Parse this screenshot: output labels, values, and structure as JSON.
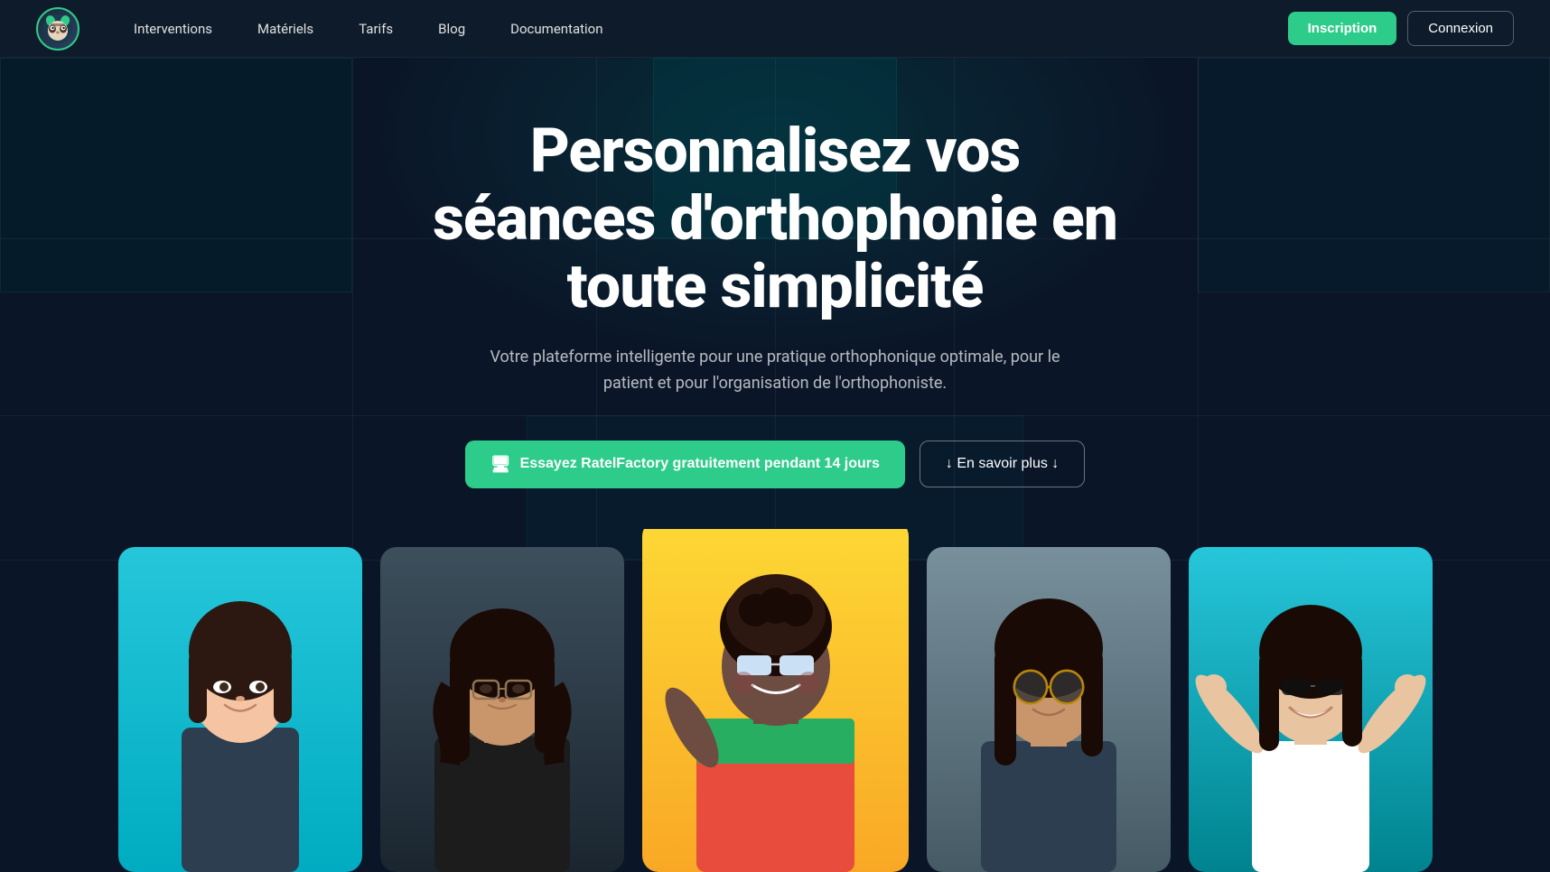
{
  "nav": {
    "links": [
      {
        "id": "interventions",
        "label": "Interventions"
      },
      {
        "id": "materiels",
        "label": "Matériels"
      },
      {
        "id": "tarifs",
        "label": "Tarifs"
      },
      {
        "id": "blog",
        "label": "Blog"
      },
      {
        "id": "documentation",
        "label": "Documentation"
      }
    ],
    "cta_primary": "Inscription",
    "cta_secondary": "Connexion"
  },
  "hero": {
    "title": "Personnalisez vos séances d'orthophonie en toute simplicité",
    "subtitle": "Votre plateforme intelligente pour une pratique orthophonique optimale, pour le patient et pour l'organisation de l'orthophoniste.",
    "btn_primary_icon": "🖥",
    "btn_primary": "Essayez RatelFactory gratuitement pendant 14 jours",
    "btn_secondary": "↓ En savoir plus ↓"
  },
  "photos": [
    {
      "id": "photo-1",
      "bg": "#00bcd4",
      "desc": "Young Asian woman smiling, cyan background"
    },
    {
      "id": "photo-2",
      "bg": "#2d3436",
      "desc": "Woman with glasses in dark setting"
    },
    {
      "id": "photo-3",
      "bg": "#fdd835",
      "desc": "Black woman with braids, yellow background, sunglasses"
    },
    {
      "id": "photo-4",
      "bg": "#90a4ae",
      "desc": "Woman with sunglasses, grey background"
    },
    {
      "id": "photo-5",
      "bg": "#00bcd4",
      "desc": "Woman celebrating arms raised, teal background"
    }
  ],
  "colors": {
    "accent": "#2ecc8a",
    "bg_dark": "#0a1628",
    "nav_bg": "#0d1b2a"
  }
}
